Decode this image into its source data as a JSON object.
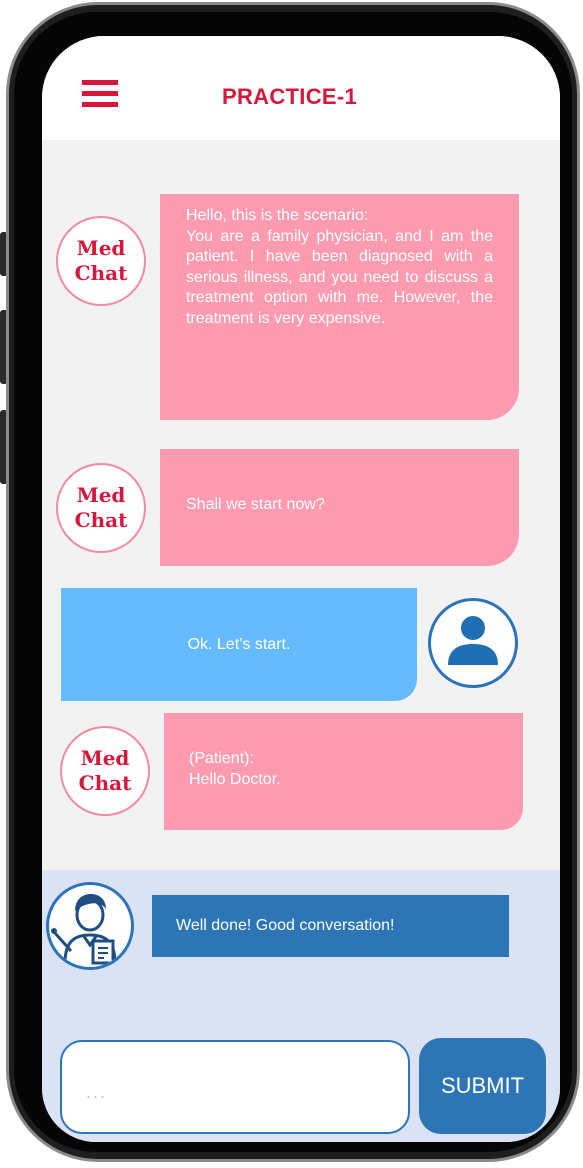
{
  "header": {
    "title": "PRACTICE-1"
  },
  "bot_avatar": {
    "line1": "Med",
    "line2": "Chat"
  },
  "messages": [
    {
      "sender": "bot",
      "lines": [
        "Hello, this is the scenario:",
        "You are a family physician, and I am the patient. I have been diagnosed with a serious illness, and you need to discuss a treatment option with me. However, the treatment is very expensive."
      ]
    },
    {
      "sender": "bot",
      "lines": [
        "Shall we start now?"
      ]
    },
    {
      "sender": "user",
      "lines": [
        "Ok. Let’s start."
      ]
    },
    {
      "sender": "bot",
      "lines": [
        "(Patient):",
        "Hello Doctor."
      ]
    }
  ],
  "feedback": {
    "text": "Well done! Good conversation!"
  },
  "input": {
    "placeholder": "..."
  },
  "submit": {
    "label": "SUBMIT"
  },
  "colors": {
    "accent_red": "#d6173c",
    "bot_bubble": "#fe9bb0",
    "user_bubble": "#66bbff",
    "panel": "#dae3f3",
    "button_blue": "#2e75b6"
  },
  "icons": {
    "menu": "hamburger-menu-icon",
    "user": "user-person-icon",
    "doctor": "doctor-tutor-icon"
  }
}
